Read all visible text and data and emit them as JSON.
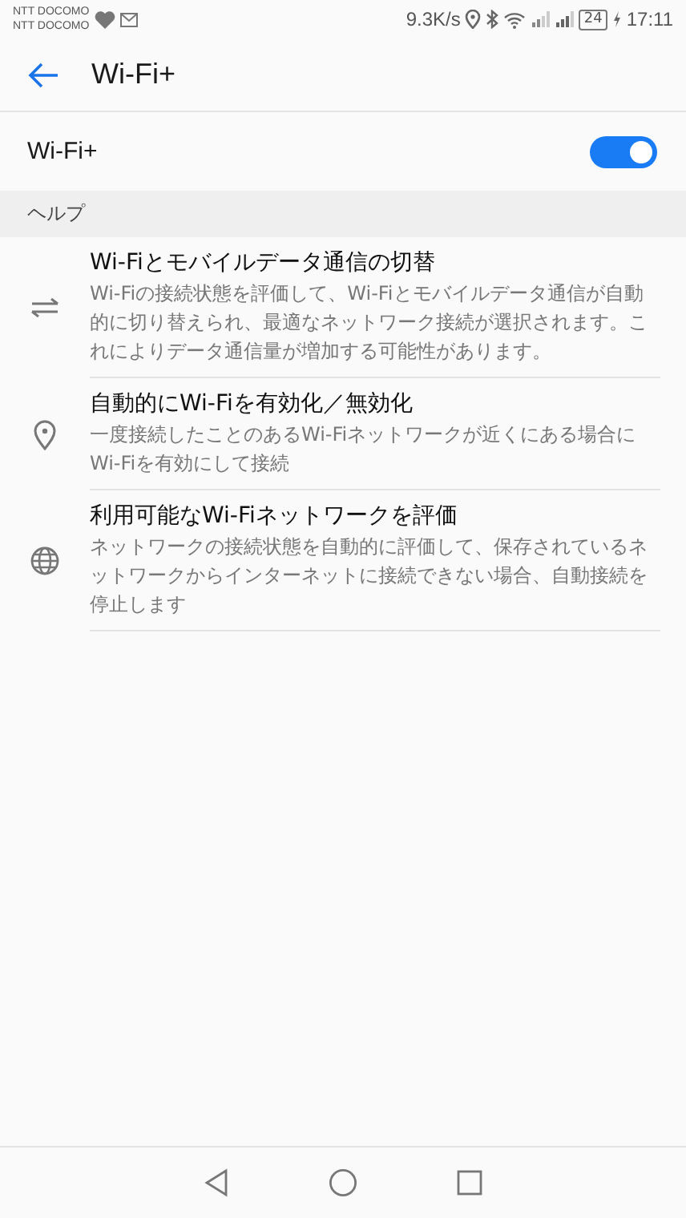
{
  "status_bar": {
    "carriers": [
      "NTT DOCOMO",
      "NTT DOCOMO"
    ],
    "speed": "9.3K/s",
    "battery": "24",
    "time": "17:11"
  },
  "header": {
    "title": "Wi-Fi+"
  },
  "toggle_row": {
    "label": "Wi-Fi+",
    "on": true
  },
  "section": {
    "title": "ヘルプ"
  },
  "help_items": [
    {
      "kind": "switch",
      "title": "Wi-Fiとモバイルデータ通信の切替",
      "description": "Wi-Fiの接続状態を評価して、Wi-Fiとモバイルデータ通信が自動的に切り替えられ、最適なネットワーク接続が選択されます。これによりデータ通信量が増加する可能性があります。"
    },
    {
      "kind": "location",
      "title": "自動的にWi-Fiを有効化／無効化",
      "description": "一度接続したことのあるWi-Fiネットワークが近くにある場合にWi-Fiを有効にして接続"
    },
    {
      "kind": "globe",
      "title": "利用可能なWi-Fiネットワークを評価",
      "description": "ネットワークの接続状態を自動的に評価して、保存されているネットワークからインターネットに接続できない場合、自動接続を停止します"
    }
  ]
}
